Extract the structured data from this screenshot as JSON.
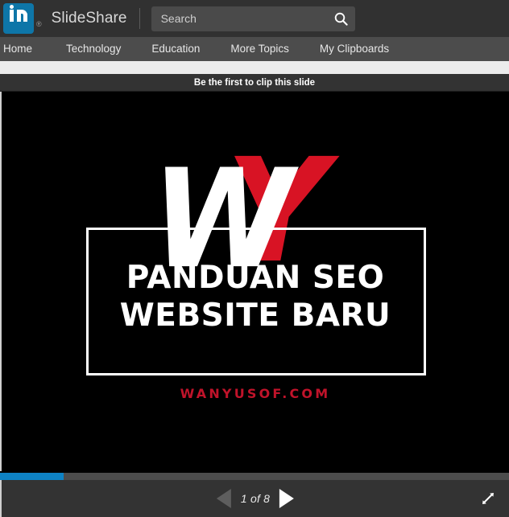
{
  "header": {
    "logo_alt": "LinkedIn",
    "registered_mark": "®",
    "brand": "SlideShare",
    "search": {
      "placeholder": "Search",
      "value": "",
      "icon": "search-icon"
    }
  },
  "nav": {
    "items": [
      {
        "label": "Home"
      },
      {
        "label": "Technology"
      },
      {
        "label": "Education"
      },
      {
        "label": "More Topics"
      },
      {
        "label": "My Clipboards"
      }
    ]
  },
  "clip_banner": {
    "label": "Be the first to clip this slide"
  },
  "slide": {
    "logo": {
      "letter_w": "W",
      "letter_y": "Y",
      "white": "#ffffff",
      "red": "#d81324"
    },
    "title_line1": "PANDUAN SEO",
    "title_line2": "WEBSITE BARU",
    "url": "WANYUSOF.COM",
    "background": "#000000"
  },
  "player": {
    "progress_percent": 12.5,
    "progress_color": "#0e82c4",
    "prev_label": "Previous slide",
    "next_label": "Next slide",
    "page_indicator": "1 of 8",
    "current_page": 1,
    "total_pages": 8,
    "fullscreen_label": "Fullscreen"
  }
}
